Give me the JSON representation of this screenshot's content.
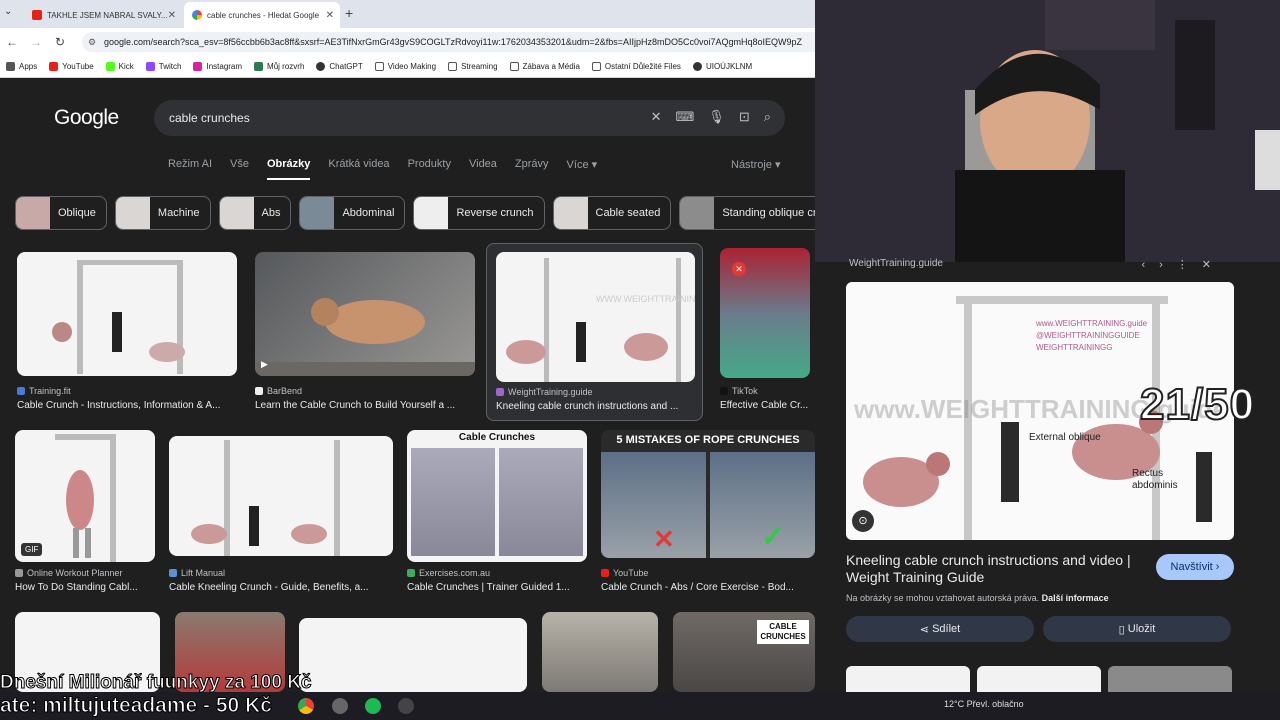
{
  "browser": {
    "tabs": [
      {
        "label": "TAKHLE JSEM NABRAL SVALY...",
        "icon": "youtube-icon",
        "active": false
      },
      {
        "label": "cable crunches - Hledat Google",
        "icon": "google-icon",
        "active": true
      }
    ],
    "url": "google.com/search?sca_esv=8f56ccbb6b3ac8ff&sxsrf=AE3TifNxrGmGr43gvS9COGLTzRdvoyi11w:1762034353201&udm=2&fbs=AIIjpHz8mDO5Cc0voi7AQgmHq8oIEQW9pZ",
    "bookmarks": [
      "Apps",
      "YouTube",
      "Kick",
      "Twitch",
      "Instagram",
      "Můj rozvrh",
      "ChatGPT",
      "Video Making",
      "Streaming",
      "Zábava a Média",
      "Ostatní Důležité Files",
      "UIOÚJKLNM"
    ]
  },
  "google": {
    "logo": "Google",
    "query": "cable crunches",
    "tabs": [
      "Režim AI",
      "Vše",
      "Obrázky",
      "Krátká videa",
      "Produkty",
      "Videa",
      "Zprávy",
      "Více"
    ],
    "tools": "Nástroje",
    "chips": [
      "Oblique",
      "Machine",
      "Abs",
      "Abdominal",
      "Reverse crunch",
      "Cable seated",
      "Standing oblique crun"
    ],
    "results_row1": [
      {
        "source": "Training.fit",
        "title": "Cable Crunch - Instructions, Information & A..."
      },
      {
        "source": "BarBend",
        "title": "Learn the Cable Crunch to Build Yourself a ..."
      },
      {
        "source": "WeightTraining.guide",
        "title": "Kneeling cable crunch instructions and ..."
      },
      {
        "source": "TikTok",
        "title": "Effective Cable Cr..."
      }
    ],
    "results_row2": [
      {
        "source": "Online Workout Planner",
        "title": "How To Do Standing Cabl...",
        "badge": "GIF"
      },
      {
        "source": "Lift Manual",
        "title": "Cable Kneeling Crunch - Guide, Benefits, a..."
      },
      {
        "source": "Exercises.com.au",
        "title": "Cable Crunches | Trainer Guided 1...",
        "caption": "Cable Crunches"
      },
      {
        "source": "YouTube",
        "title": "Cable Crunch - Abs / Core Exercise - Bod...",
        "caption": "5 MISTAKES OF ROPE CRUNCHES"
      }
    ],
    "row3_caption": "CABLE CRUNCHES"
  },
  "preview": {
    "site": "WeightTraining.guide",
    "watermark": "www.WEIGHTTRAINING.guide",
    "handle1": "@WEIGHTTRAININGGUIDE",
    "handle2": "WEIGHTTRAININGG",
    "label_oblique": "External oblique",
    "label_rectus": "Rectus abdominis",
    "title": "Kneeling cable crunch instructions and video | Weight Training Guide",
    "visit": "Navštívit",
    "copyright": "Na obrázky se mohou vztahovat autorská práva.",
    "more_info": "Další informace",
    "share": "Sdílet",
    "save": "Uložit"
  },
  "overlay": {
    "counter": "21/50",
    "ticker_line1": "Dnešní Milionář fuunkyy za 100 Kč",
    "ticker_line2": "ate: miltujuteadame - 50 Kč"
  },
  "taskbar": {
    "weather": "12°C  Převl. oblačno"
  }
}
